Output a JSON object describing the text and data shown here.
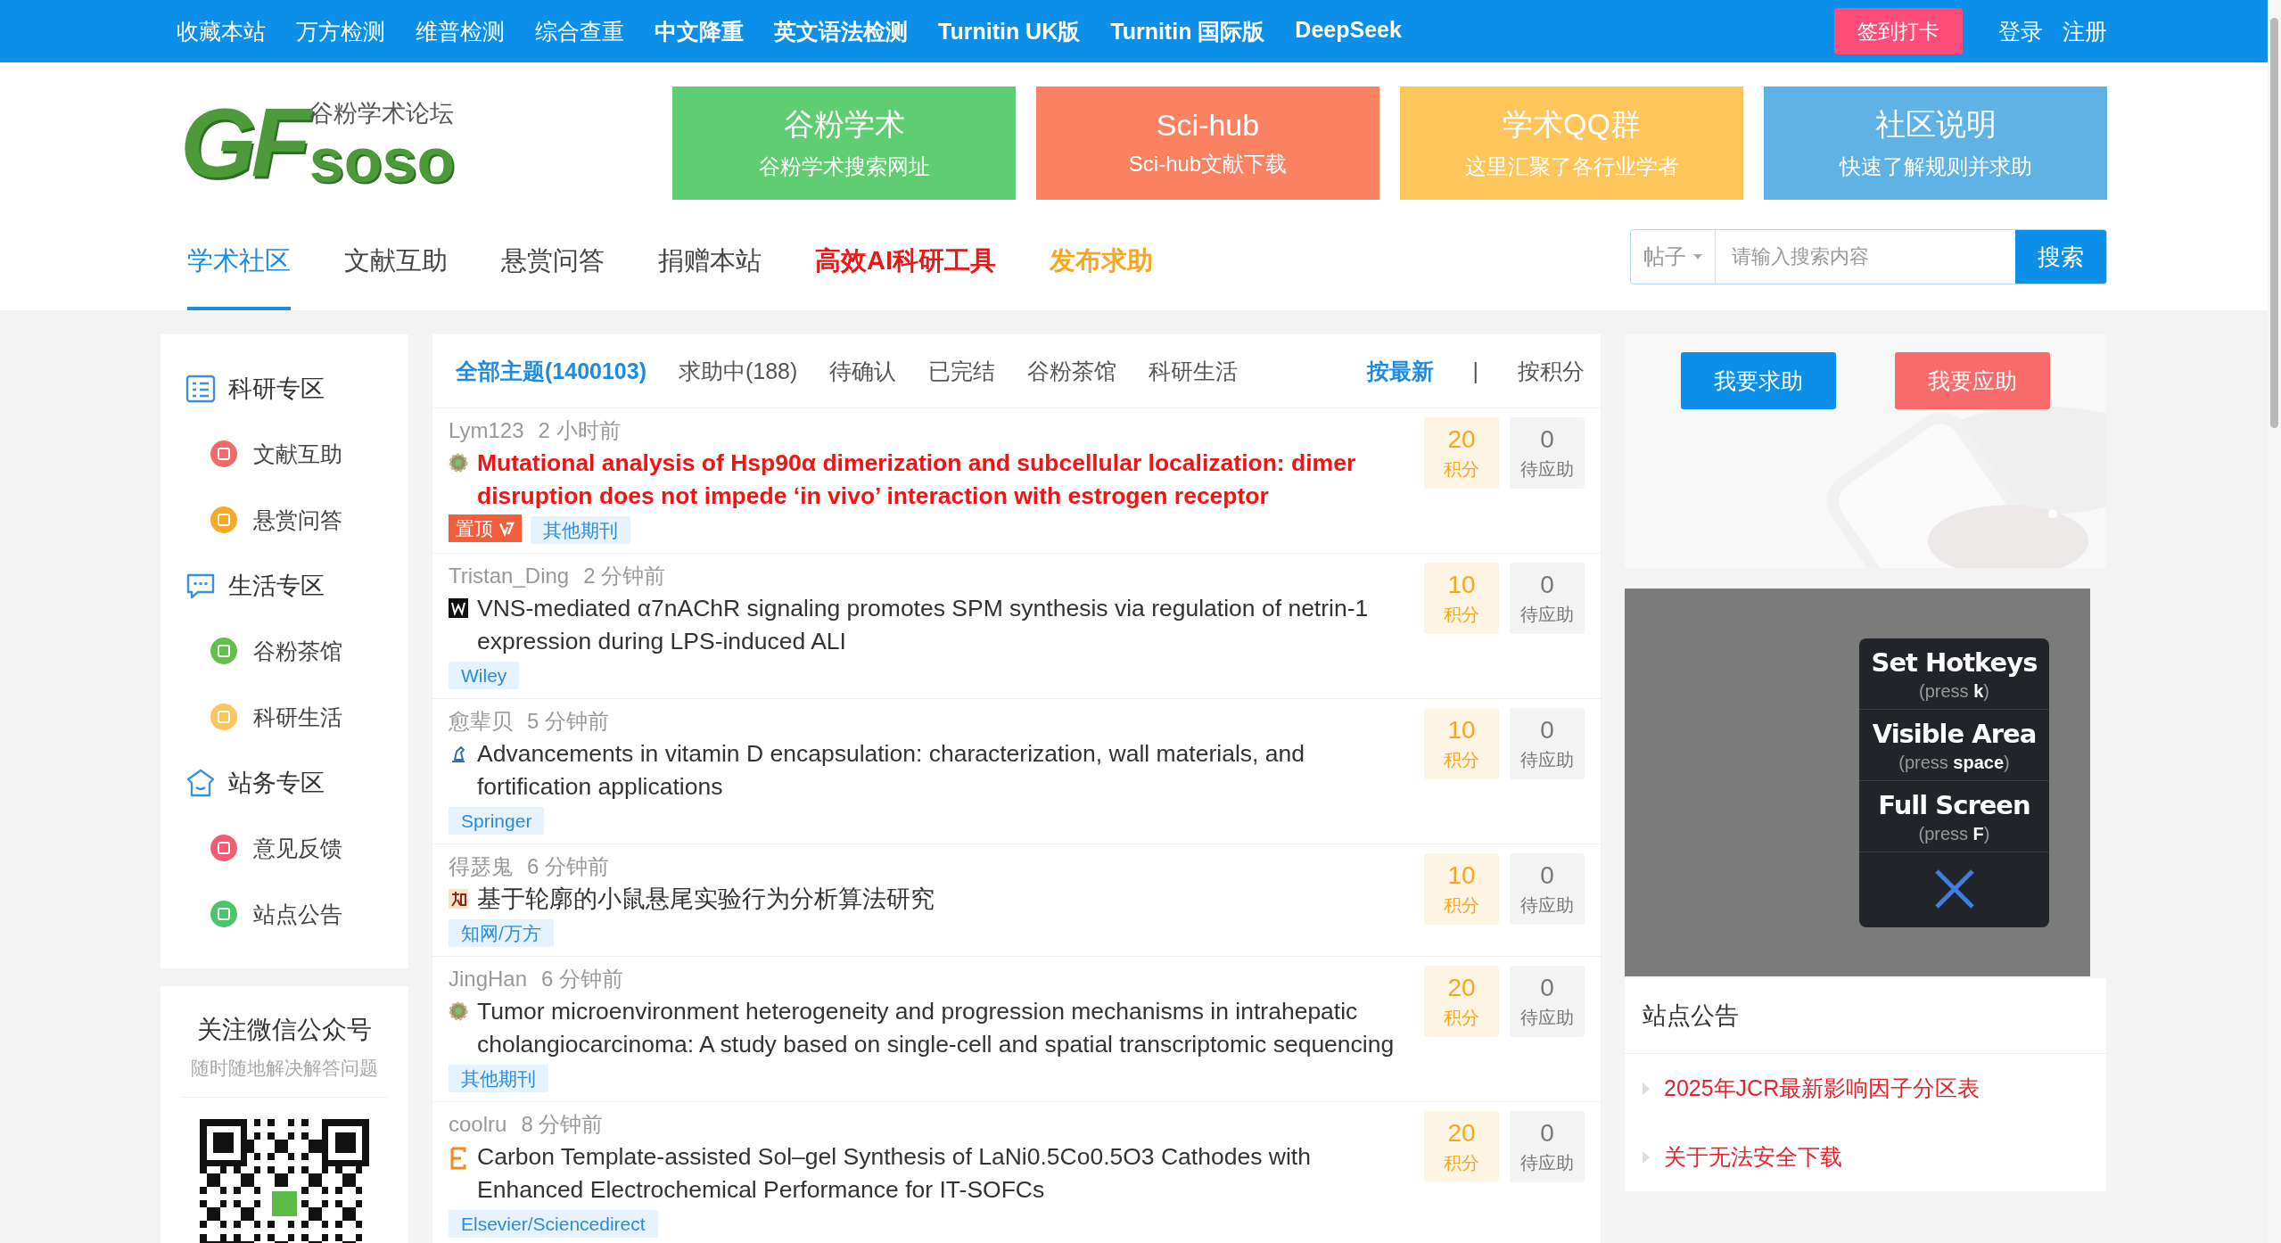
{
  "top_bar": {
    "links": [
      {
        "label": "收藏本站",
        "bold": false
      },
      {
        "label": "万方检测",
        "bold": false
      },
      {
        "label": "维普检测",
        "bold": false
      },
      {
        "label": "综合查重",
        "bold": false
      },
      {
        "label": "中文降重",
        "bold": true
      },
      {
        "label": "英文语法检测",
        "bold": true
      },
      {
        "label": "Turnitin UK版",
        "bold": true
      },
      {
        "label": "Turnitin 国际版",
        "bold": true
      },
      {
        "label": "DeepSeek",
        "bold": true
      }
    ],
    "checkin_button": "签到打卡",
    "login": "登录",
    "register": "注册"
  },
  "logo": {
    "letters": "GF",
    "word": "soso",
    "tagline": "谷粉学术论坛"
  },
  "banners": [
    {
      "title": "谷粉学术",
      "subtitle": "谷粉学术搜索网址",
      "color": "#5fcd72"
    },
    {
      "title": "Sci-hub",
      "subtitle": "Sci-hub文献下载",
      "color": "#fb8163"
    },
    {
      "title": "学术QQ群",
      "subtitle": "这里汇聚了各行业学者",
      "color": "#fec55a"
    },
    {
      "title": "社区说明",
      "subtitle": "快速了解规则并求助",
      "color": "#5fb2e6"
    }
  ],
  "nav": [
    {
      "label": "学术社区",
      "kind": "plain",
      "selected": true
    },
    {
      "label": "文献互助",
      "kind": "plain",
      "selected": false
    },
    {
      "label": "悬赏问答",
      "kind": "plain",
      "selected": false
    },
    {
      "label": "捐赠本站",
      "kind": "plain",
      "selected": false
    },
    {
      "label": "高效AI科研工具",
      "kind": "hot",
      "selected": false
    },
    {
      "label": "发布求助",
      "kind": "accent",
      "selected": false
    }
  ],
  "search": {
    "scope": "帖子",
    "placeholder": "请输入搜索内容",
    "button": "搜索"
  },
  "sidebar": {
    "groups": [
      {
        "title": "科研专区",
        "kind": "list",
        "items": [
          {
            "label": "文献互助",
            "color": "#f26a6a"
          },
          {
            "label": "悬赏问答",
            "color": "#f7a928"
          }
        ]
      },
      {
        "title": "生活专区",
        "kind": "chat",
        "items": [
          {
            "label": "谷粉茶馆",
            "color": "#62c04a"
          },
          {
            "label": "科研生活",
            "color": "#fbc55b"
          }
        ]
      },
      {
        "title": "站务专区",
        "kind": "home",
        "items": [
          {
            "label": "意见反馈",
            "color": "#f45c74"
          },
          {
            "label": "站点公告",
            "color": "#4cc46a"
          }
        ]
      }
    ],
    "wechat": {
      "title": "关注微信公众号",
      "subtitle": "随时随地解决解答问题"
    }
  },
  "tabs": [
    {
      "label": "全部主题(1400103)",
      "selected": true
    },
    {
      "label": "求助中(188)",
      "selected": false
    },
    {
      "label": "待确认",
      "selected": false
    },
    {
      "label": "已完结",
      "selected": false
    },
    {
      "label": "谷粉茶馆",
      "selected": false
    },
    {
      "label": "科研生活",
      "selected": false
    }
  ],
  "sort": [
    {
      "label": "按最新",
      "selected": true
    },
    {
      "label": "按积分",
      "selected": false
    }
  ],
  "sort_divider": "|",
  "topics": [
    {
      "author": "Lym123",
      "time": "2 小时前",
      "kind": "journal",
      "title": "Mutational analysis of Hsp90α dimerization and subcellular localization: dimer disruption does not impede ‘in vivo’ interaction with estrogen receptor",
      "pinned": true,
      "pin_label": "置顶",
      "tag": "其他期刊",
      "score": "20",
      "score_label": "积分",
      "replies": "0",
      "replies_label": "待应助"
    },
    {
      "author": "Tristan_Ding",
      "time": "2 分钟前",
      "kind": "wiley",
      "title": "VNS-mediated α7nAChR signaling promotes SPM synthesis via regulation of netrin-1 expression during LPS-induced ALI",
      "pinned": false,
      "tag": "Wiley",
      "score": "10",
      "score_label": "积分",
      "replies": "0",
      "replies_label": "待应助"
    },
    {
      "author": "愈辈贝",
      "time": "5 分钟前",
      "kind": "springer",
      "title": "Advancements in vitamin D encapsulation: characterization, wall materials, and fortification applications",
      "pinned": false,
      "tag": "Springer",
      "score": "10",
      "score_label": "积分",
      "replies": "0",
      "replies_label": "待应助"
    },
    {
      "author": "得瑟鬼",
      "time": "6 分钟前",
      "kind": "cnki",
      "title": "基于轮廓的小鼠悬尾实验行为分析算法研究",
      "pinned": false,
      "tag": "知网/万方",
      "score": "10",
      "score_label": "积分",
      "replies": "0",
      "replies_label": "待应助"
    },
    {
      "author": "JingHan",
      "time": "6 分钟前",
      "kind": "journal",
      "title": "Tumor microenvironment heterogeneity and progression mechanisms in intrahepatic cholangiocarcinoma: A study based on single-cell and spatial transcriptomic sequencing",
      "pinned": false,
      "tag": "其他期刊",
      "score": "20",
      "score_label": "积分",
      "replies": "0",
      "replies_label": "待应助"
    },
    {
      "author": "coolru",
      "time": "8 分钟前",
      "kind": "elsevier",
      "title": "Carbon Template-assisted Sol–gel Synthesis of LaNi0.5Co0.5O3 Cathodes with Enhanced Electrochemical Performance for IT-SOFCs",
      "pinned": false,
      "tag": "Elsevier/Sciencedirect",
      "score": "20",
      "score_label": "积分",
      "replies": "0",
      "replies_label": "待应助"
    }
  ],
  "actions": {
    "ask": "我要求助",
    "answer": "我要应助"
  },
  "hotkeys": [
    {
      "title": "Set Hotkeys",
      "hint": "(press **k**)"
    },
    {
      "title": "Visible Area",
      "hint": "(press **space**)"
    },
    {
      "title": "Full Screen",
      "hint": "(press **F**)"
    }
  ],
  "notices": {
    "title": "站点公告",
    "items": [
      "2025年JCR最新影响因子分区表",
      "关于无法安全下载"
    ]
  }
}
